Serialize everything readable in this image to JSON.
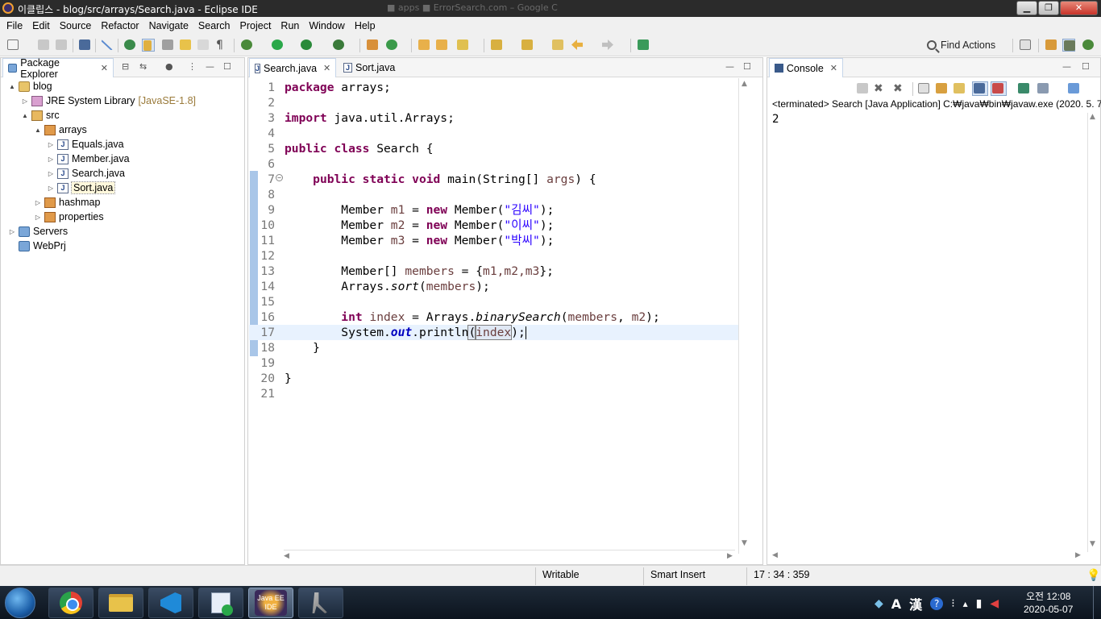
{
  "window": {
    "title": "이클립스 - blog/src/arrays/Search.java - Eclipse IDE",
    "bg_tabs": "■ apps                           ■ ErrorSearch.com – Google C"
  },
  "menu": [
    "File",
    "Edit",
    "Source",
    "Refactor",
    "Navigate",
    "Search",
    "Project",
    "Run",
    "Window",
    "Help"
  ],
  "toolbar": {
    "find_actions": "Find Actions"
  },
  "package_explorer": {
    "tab_label": "Package Explorer",
    "tree": [
      {
        "label": "blog",
        "icon": "project-icon",
        "twisty": "▲",
        "deco": ""
      },
      {
        "label": "JRE System Library",
        "icon": "library-icon",
        "twisty": "▷",
        "deco": "[JavaSE-1.8]"
      },
      {
        "label": "src",
        "icon": "source-folder-icon",
        "twisty": "▲",
        "deco": ""
      },
      {
        "label": "arrays",
        "icon": "package-icon",
        "twisty": "▲",
        "deco": ""
      },
      {
        "label": "Equals.java",
        "icon": "java-file-icon",
        "twisty": "▷",
        "deco": ""
      },
      {
        "label": "Member.java",
        "icon": "java-file-icon",
        "twisty": "▷",
        "deco": ""
      },
      {
        "label": "Search.java",
        "icon": "java-file-icon",
        "twisty": "▷",
        "deco": ""
      },
      {
        "label": "Sort.java",
        "icon": "java-file-icon",
        "twisty": "▷",
        "deco": ""
      },
      {
        "label": "hashmap",
        "icon": "package-icon",
        "twisty": "▷",
        "deco": ""
      },
      {
        "label": "properties",
        "icon": "package-icon",
        "twisty": "▷",
        "deco": ""
      },
      {
        "label": "Servers",
        "icon": "folder-icon",
        "twisty": "▷",
        "deco": ""
      },
      {
        "label": "WebPrj",
        "icon": "folder-icon",
        "twisty": "",
        "deco": ""
      }
    ]
  },
  "editor": {
    "tabs": [
      {
        "label": "Search.java",
        "active": true
      },
      {
        "label": "Sort.java",
        "active": false
      }
    ],
    "line_numbers": [
      "1",
      "2",
      "3",
      "4",
      "5",
      "6",
      "7",
      "8",
      "9",
      "10",
      "11",
      "12",
      "13",
      "14",
      "15",
      "16",
      "17",
      "18",
      "19",
      "20",
      "21"
    ],
    "code": {
      "l1_kw": "package",
      "l1_rest": " arrays;",
      "l3_kw": "import",
      "l3_rest": " java.util.Arrays;",
      "l5_kw1": "public",
      "l5_kw2": "class",
      "l5_rest": " Search {",
      "l7_indent": "    ",
      "l7_kw": "public static void",
      "l7_a": " main(String[] ",
      "l7_args": "args",
      "l7_b": ") {",
      "l9_a": "        Member ",
      "l9_v": "m1",
      "l9_b": " = ",
      "l9_kw": "new",
      "l9_c": " Member(",
      "l9_str": "\"김씨\"",
      "l9_d": ");",
      "l10_a": "        Member ",
      "l10_v": "m2",
      "l10_b": " = ",
      "l10_kw": "new",
      "l10_c": " Member(",
      "l10_str": "\"이씨\"",
      "l10_d": ");",
      "l11_a": "        Member ",
      "l11_v": "m3",
      "l11_b": " = ",
      "l11_kw": "new",
      "l11_c": " Member(",
      "l11_str": "\"박씨\"",
      "l11_d": ");",
      "l13_a": "        Member[] ",
      "l13_v": "members",
      "l13_b": " = {",
      "l13_c": "m1,m2,m3",
      "l13_d": "};",
      "l14_a": "        Arrays.",
      "l14_m": "sort",
      "l14_b": "(",
      "l14_v": "members",
      "l14_c": ");",
      "l16_indent": "        ",
      "l16_kw": "int",
      "l16_a": " ",
      "l16_v": "index",
      "l16_b": " = Arrays.",
      "l16_m": "binarySearch",
      "l16_c": "(",
      "l16_v2": "members",
      "l16_d": ", ",
      "l16_v3": "m2",
      "l16_e": ");",
      "l17_a": "        System.",
      "l17_f": "out",
      "l17_b": ".println",
      "l17_c": "(",
      "l17_v": "index",
      "l17_d": ");",
      "l18": "    }",
      "l20": "}"
    }
  },
  "console": {
    "tab_label": "Console",
    "terminated": "<terminated> Search [Java Application] C:₩java₩bin₩javaw.exe  (2020. 5. 7.",
    "output": "2"
  },
  "statusbar": {
    "writable": "Writable",
    "insert_mode": "Smart Insert",
    "position": "17 : 34 : 359"
  },
  "taskbar": {
    "javaee_label": "Java EE IDE",
    "ime_a": "A",
    "ime_han": "漢",
    "clock_time": "오전 12:08",
    "clock_date": "2020-05-07"
  },
  "colors": {
    "keyword": "#7f0055",
    "string": "#2a00ff",
    "field": "#0000c0",
    "local_var": "#6a3e3e",
    "current_line": "#e8f2fe"
  }
}
